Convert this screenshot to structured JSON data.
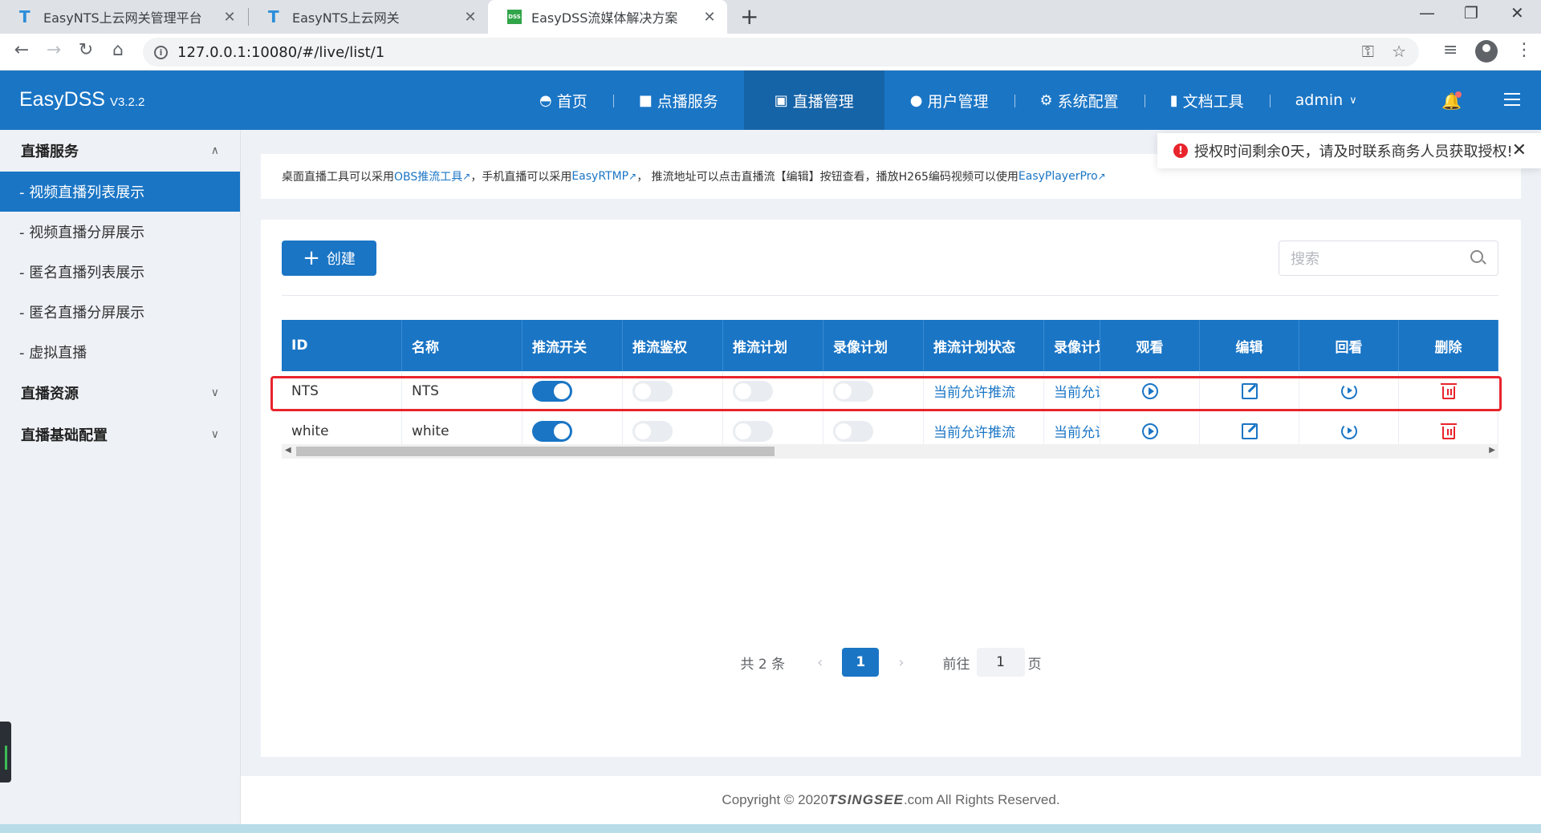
{
  "browser": {
    "tabs": [
      {
        "title": "EasyNTS上云网关管理平台",
        "active": false
      },
      {
        "title": "EasyNTS上云网关",
        "active": false
      },
      {
        "title": "EasyDSS流媒体解决方案",
        "active": true
      }
    ],
    "url": "127.0.0.1:10080/#/live/list/1",
    "new_tab": "+",
    "window_controls": {
      "minimize": "—",
      "maximize": "❐",
      "close": "✕"
    }
  },
  "app": {
    "brand": "EasyDSS",
    "version": "V3.2.2",
    "nav": [
      {
        "label": "首页",
        "icon": "dashboard-icon",
        "active": false
      },
      {
        "label": "点播服务",
        "icon": "video-camera-icon",
        "active": false
      },
      {
        "label": "直播管理",
        "icon": "live-tv-icon",
        "active": true
      },
      {
        "label": "用户管理",
        "icon": "user-icon",
        "active": false
      },
      {
        "label": "系统配置",
        "icon": "gear-icon",
        "active": false
      },
      {
        "label": "文档工具",
        "icon": "book-icon",
        "active": false
      }
    ],
    "user": "admin"
  },
  "sidebar": {
    "groups": [
      {
        "label": "直播服务",
        "expanded": true,
        "items": [
          {
            "label": "- 视频直播列表展示",
            "active": true
          },
          {
            "label": "- 视频直播分屏展示",
            "active": false
          },
          {
            "label": "- 匿名直播列表展示",
            "active": false
          },
          {
            "label": "- 匿名直播分屏展示",
            "active": false
          },
          {
            "label": "- 虚拟直播",
            "active": false
          }
        ]
      },
      {
        "label": "直播资源",
        "expanded": false
      },
      {
        "label": "直播基础配置",
        "expanded": false
      }
    ]
  },
  "notice": {
    "t1": "桌面直播工具可以采用 ",
    "l1": "OBS推流工具",
    "t2": "，手机直播可以采用 ",
    "l2": "EasyRTMP",
    "t3": "，  推流地址可以点击直播流【编辑】按钮查看，播放H265编码视频可以使用 ",
    "l3": "EasyPlayerPro"
  },
  "toast": {
    "message": "授权时间剩余0天，请及时联系商务人员获取授权!"
  },
  "toolbar": {
    "create_label": "创建",
    "search_placeholder": "搜索"
  },
  "table": {
    "headers": [
      "ID",
      "名称",
      "推流开关",
      "推流鉴权",
      "推流计划",
      "录像计划",
      "推流计划状态",
      "录像计划",
      "观看",
      "编辑",
      "回看",
      "删除"
    ],
    "rows": [
      {
        "id": "NTS",
        "name": "NTS",
        "push_switch": true,
        "push_auth": false,
        "push_plan": false,
        "record_plan": false,
        "push_plan_status": "当前允许推流",
        "record_plan_status": "当前允许"
      },
      {
        "id": "white",
        "name": "white",
        "push_switch": true,
        "push_auth": false,
        "push_plan": false,
        "record_plan": false,
        "push_plan_status": "当前允许推流",
        "record_plan_status": "当前允许"
      }
    ]
  },
  "pagination": {
    "total": "共 2 条",
    "current": "1",
    "goto_label": "前往",
    "goto_value": "1",
    "page_suffix": "页"
  },
  "footer": {
    "prefix": "Copyright © 2020 ",
    "brand": "TSINGSEE",
    "suffix": ".com All Rights Reserved."
  },
  "colors": {
    "primary": "#1a75c5",
    "danger": "#e8242c",
    "background": "#eef1f6"
  }
}
